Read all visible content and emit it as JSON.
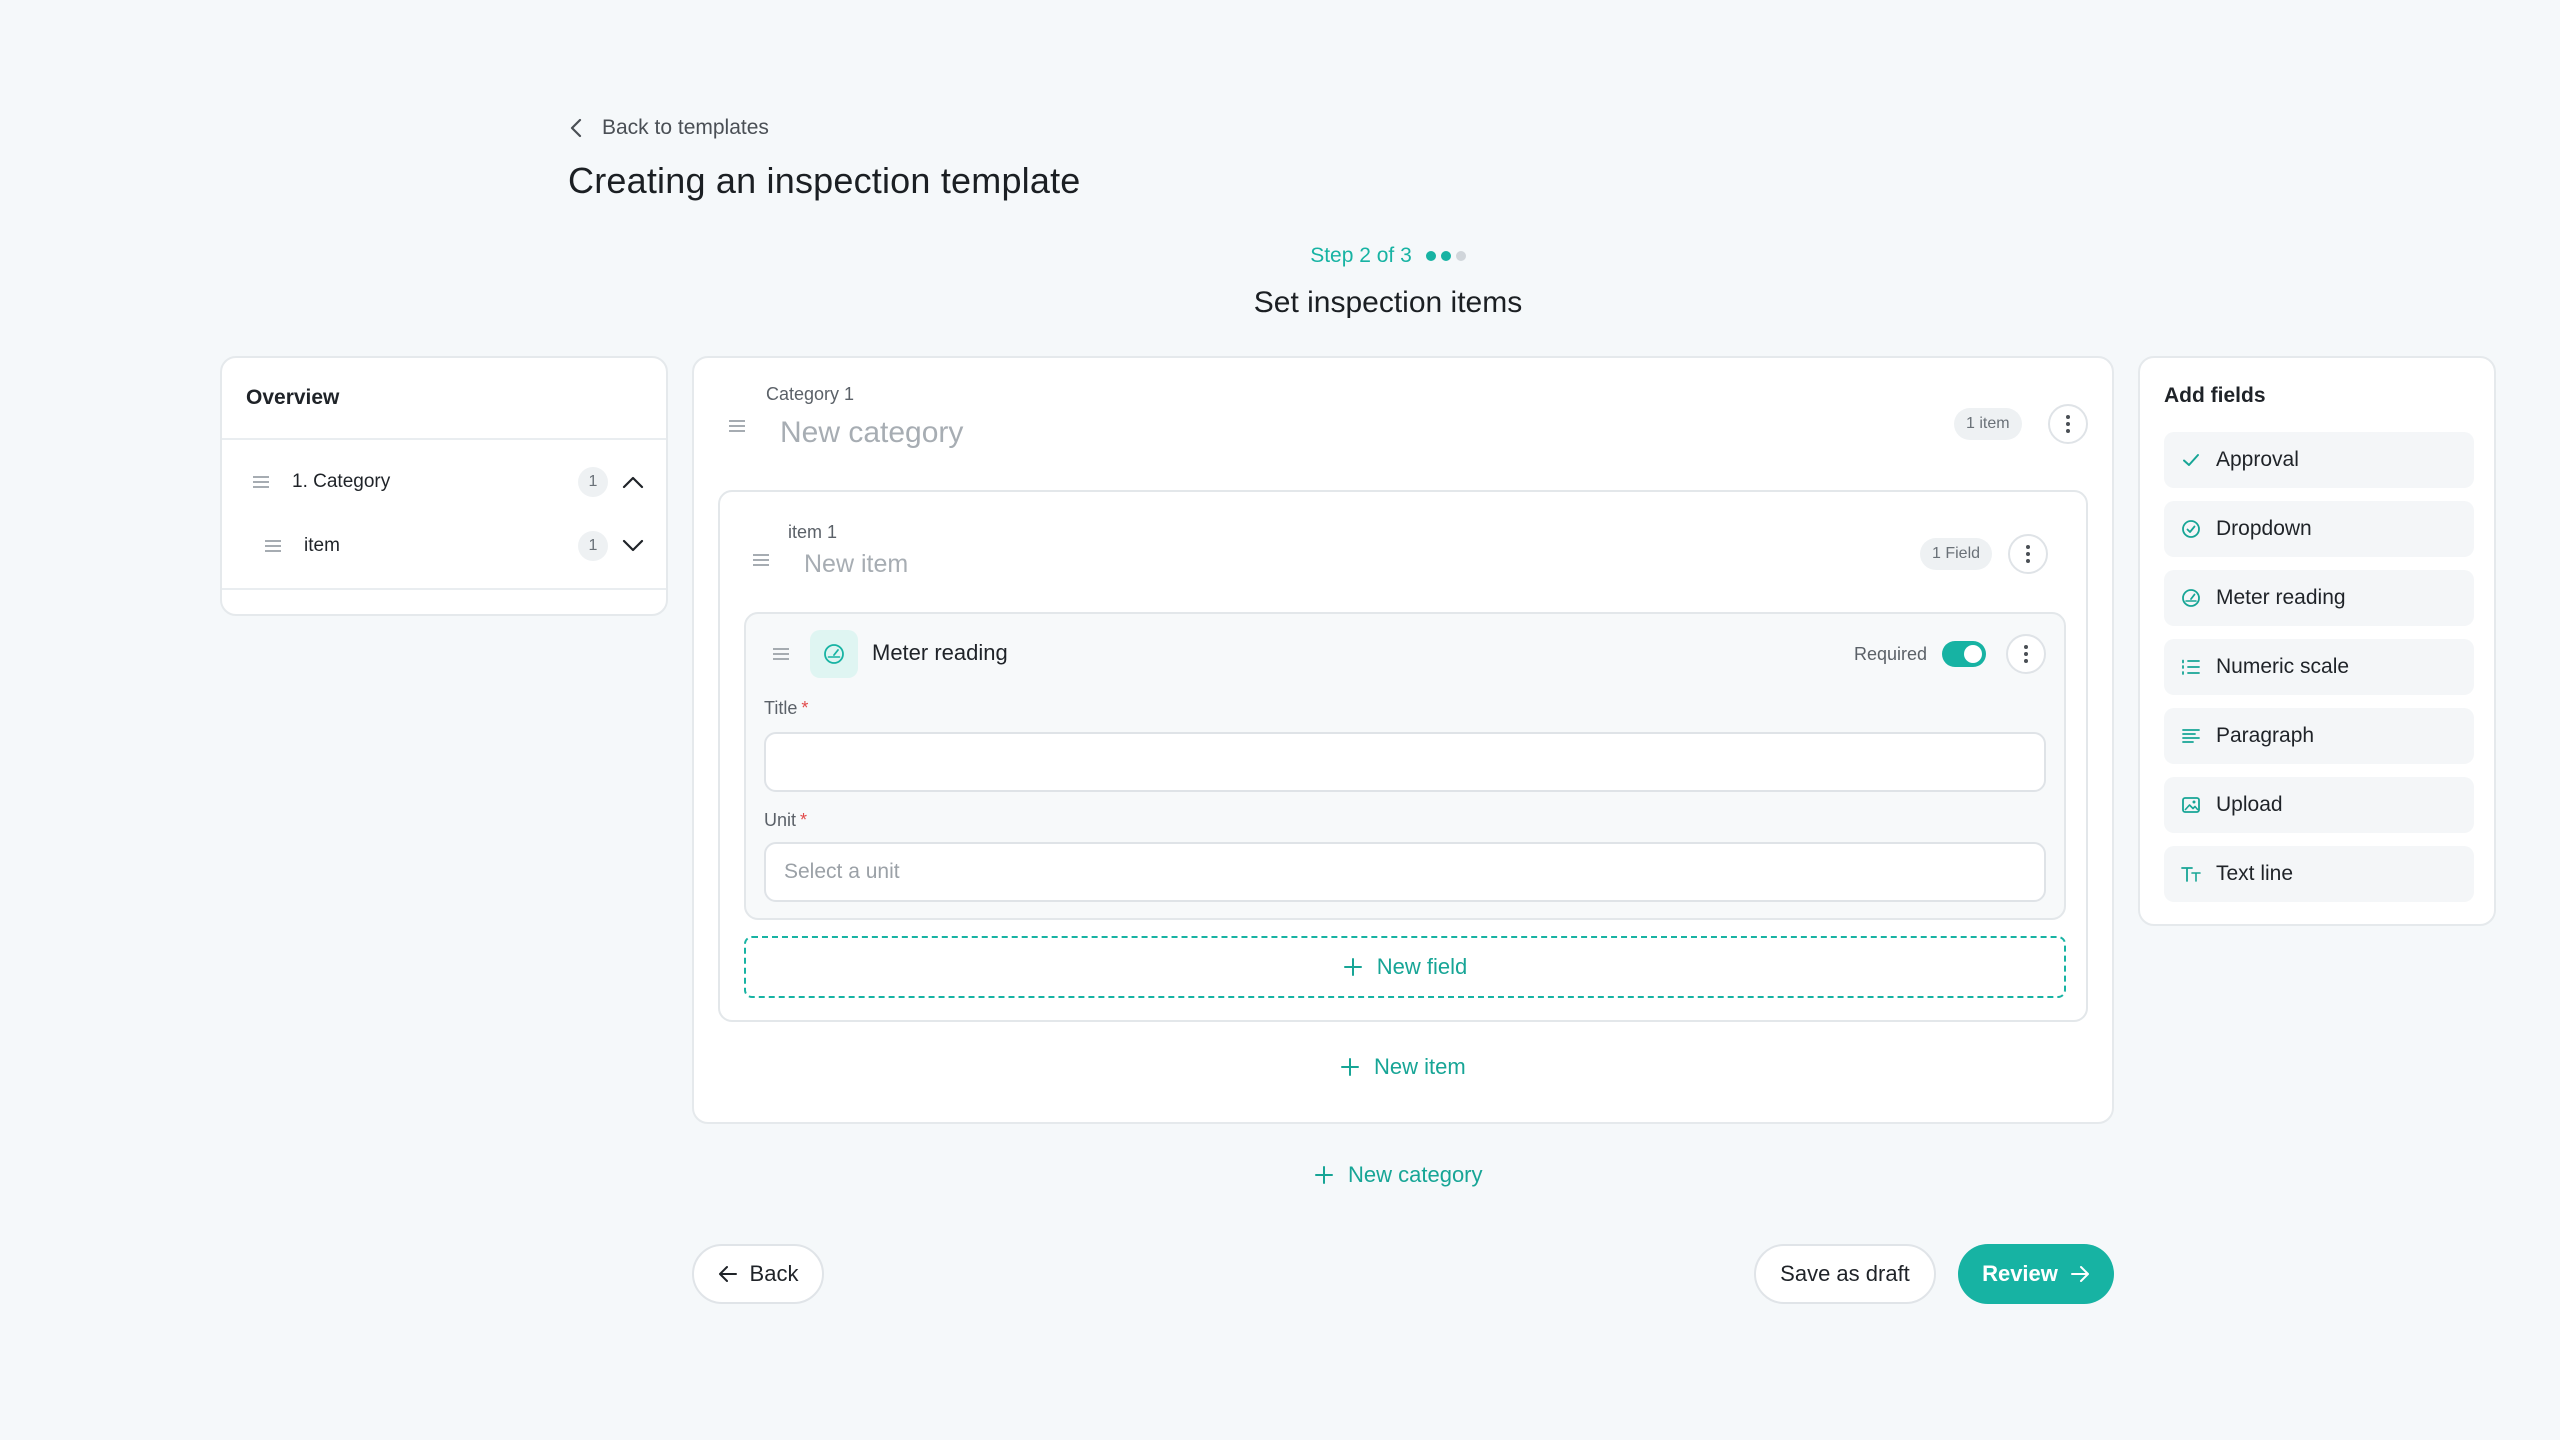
{
  "header": {
    "back_label": "Back to templates",
    "page_title": "Creating an inspection template",
    "step_text": "Step 2 of 3",
    "step_current": 2,
    "step_total": 3,
    "section_title": "Set inspection items"
  },
  "overview": {
    "title": "Overview",
    "rows": [
      {
        "label": "1.  Category",
        "count": "1",
        "state": "expanded"
      },
      {
        "label": "item",
        "count": "1",
        "state": "collapsed"
      }
    ]
  },
  "category": {
    "label": "Category 1",
    "name": "New category",
    "count_badge": "1 item",
    "item": {
      "label": "item 1",
      "name": "New item",
      "count_badge": "1 Field",
      "field": {
        "type_label": "Meter reading",
        "icon": "gauge-icon",
        "required_label": "Required",
        "required": true,
        "title_label": "Title",
        "title_value": "",
        "unit_label": "Unit",
        "unit_placeholder": "Select a unit"
      },
      "new_field_label": "New field"
    },
    "new_item_label": "New item"
  },
  "new_category_label": "New category",
  "add_fields": {
    "title": "Add fields",
    "items": [
      {
        "label": "Approval",
        "icon": "check-icon"
      },
      {
        "label": "Dropdown",
        "icon": "circle-check-icon"
      },
      {
        "label": "Meter reading",
        "icon": "gauge-icon"
      },
      {
        "label": "Numeric scale",
        "icon": "numbered-list-icon"
      },
      {
        "label": "Paragraph",
        "icon": "paragraph-icon"
      },
      {
        "label": "Upload",
        "icon": "image-icon"
      },
      {
        "label": "Text line",
        "icon": "text-icon"
      }
    ]
  },
  "footer": {
    "back_label": "Back",
    "save_draft_label": "Save as draft",
    "review_label": "Review"
  },
  "colors": {
    "accent": "#17b3a3",
    "background": "#f5f8fa",
    "required_star": "#e24a4a"
  }
}
